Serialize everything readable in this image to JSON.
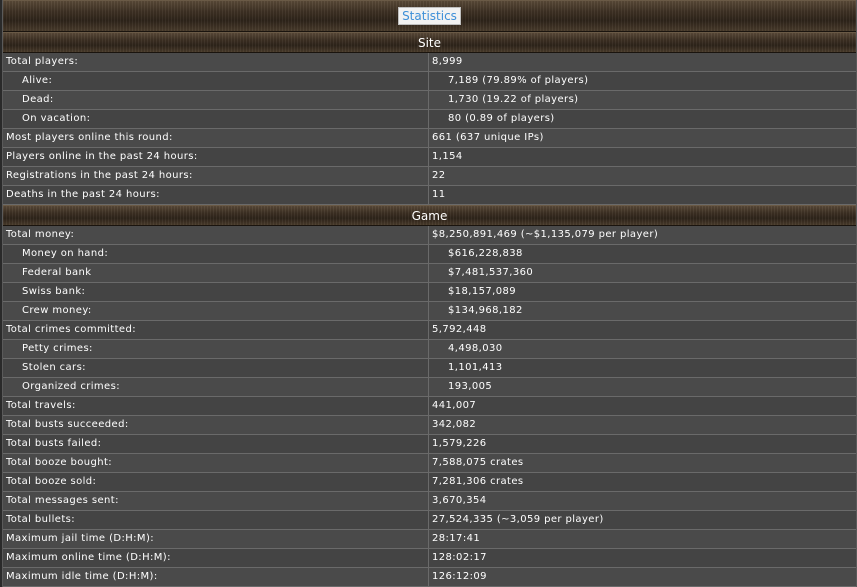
{
  "title": "Statistics",
  "sections": {
    "site": {
      "label": "Site",
      "rows": [
        {
          "label": "Total players:",
          "value": "8,999"
        },
        {
          "label": "Alive:",
          "value": "7,189 (79.89% of players)"
        },
        {
          "label": "Dead:",
          "value": "1,730 (19.22 of players)"
        },
        {
          "label": "On vacation:",
          "value": "80 (0.89 of players)"
        },
        {
          "label": "Most players online this round:",
          "value": "661 (637 unique IPs)"
        },
        {
          "label": "Players online in the past 24 hours:",
          "value": "1,154"
        },
        {
          "label": "Registrations in the past 24 hours:",
          "value": "22"
        },
        {
          "label": "Deaths in the past 24 hours:",
          "value": "11"
        }
      ]
    },
    "game": {
      "label": "Game",
      "rows": [
        {
          "label": "Total money:",
          "value": "$8,250,891,469 (~$1,135,079 per player)"
        },
        {
          "label": "Money on hand:",
          "value": "$616,228,838"
        },
        {
          "label": "Federal bank",
          "value": "$7,481,537,360"
        },
        {
          "label": "Swiss bank:",
          "value": "$18,157,089"
        },
        {
          "label": "Crew money:",
          "value": "$134,968,182"
        },
        {
          "label": "Total crimes committed:",
          "value": "5,792,448"
        },
        {
          "label": "Petty crimes:",
          "value": "4,498,030"
        },
        {
          "label": "Stolen cars:",
          "value": "1,101,413"
        },
        {
          "label": "Organized crimes:",
          "value": "193,005"
        },
        {
          "label": "Total travels:",
          "value": "441,007"
        },
        {
          "label": "Total busts succeeded:",
          "value": "342,082"
        },
        {
          "label": "Total busts failed:",
          "value": "1,579,226"
        },
        {
          "label": "Total booze bought:",
          "value": "7,588,075 crates"
        },
        {
          "label": "Total booze sold:",
          "value": "7,281,306 crates"
        },
        {
          "label": "Total messages sent:",
          "value": "3,670,354"
        },
        {
          "label": "Total bullets:",
          "value": "27,524,335 (~3,059 per player)"
        },
        {
          "label": "Maximum jail time (D:H:M):",
          "value": "28:17:41"
        },
        {
          "label": "Maximum online time (D:H:M):",
          "value": "128:02:17"
        },
        {
          "label": "Maximum idle time (D:H:M):",
          "value": "126:12:09"
        }
      ]
    }
  }
}
